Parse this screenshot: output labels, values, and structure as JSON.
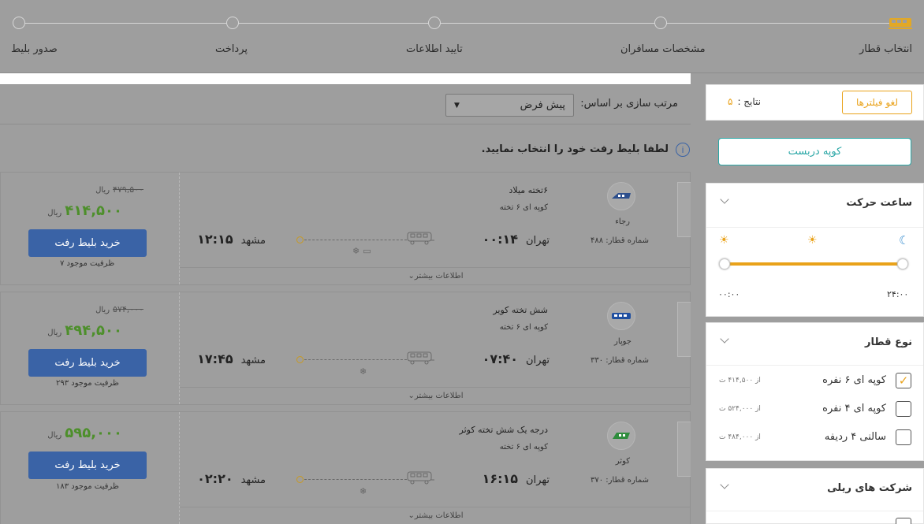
{
  "stepper": {
    "steps": [
      {
        "label": "انتخاب قطار"
      },
      {
        "label": "مشخصات مسافران"
      },
      {
        "label": "تایید اطلاعات"
      },
      {
        "label": "پرداخت"
      },
      {
        "label": "صدور بلیط"
      }
    ]
  },
  "sort": {
    "label": "مرتب سازی بر اساس:",
    "selected": "پیش فرض"
  },
  "notice": "لطفا بلیط رفت خود را انتخاب نمایید.",
  "tickets": [
    {
      "train_name": "۶تخته میلاد",
      "coupe": "کوپه ای ۶ تخته",
      "company": "رجاء",
      "train_number": "شماره قطار: ۴۸۸",
      "origin": "تهران",
      "depart_time": "۰۰:۱۴",
      "destination": "مشهد",
      "arrive_time": "۱۲:۱۵",
      "old_price": "۴۷۹,۵۰۰",
      "old_currency": "ریال",
      "price": "۴۱۴,۵۰۰",
      "currency": "ریال",
      "buy_label": "خرید بلیط رفت",
      "capacity": "ظرفیت موجود ۷",
      "more": "اطلاعات بیشتر"
    },
    {
      "train_name": "شش تخته کویر",
      "coupe": "کوپه ای ۶ تخته",
      "company": "جوپار",
      "train_number": "شماره قطار: ۳۳۰",
      "origin": "تهران",
      "depart_time": "۰۷:۴۰",
      "destination": "مشهد",
      "arrive_time": "۱۷:۴۵",
      "old_price": "۵۷۴,۰۰۰",
      "old_currency": "ریال",
      "price": "۴۹۴,۵۰۰",
      "currency": "ریال",
      "buy_label": "خرید بلیط رفت",
      "capacity": "ظرفیت موجود ۲۹۳",
      "more": "اطلاعات بیشتر"
    },
    {
      "train_name": "درجه یک شش تخته کوثر",
      "coupe": "کوپه ای ۶ تخته",
      "company": "کوثر",
      "train_number": "شماره قطار: ۳۷۰",
      "origin": "تهران",
      "depart_time": "۱۶:۱۵",
      "destination": "مشهد",
      "arrive_time": "۰۲:۲۰",
      "old_price": "",
      "old_currency": "",
      "price": "۵۹۵,۰۰۰",
      "currency": "ریال",
      "buy_label": "خرید بلیط رفت",
      "capacity": "ظرفیت موجود ۱۸۳",
      "more": "اطلاعات بیشتر"
    }
  ],
  "sidebar": {
    "clear_filters": "لغو فیلترها",
    "results_label": "نتایج :",
    "results_count": "۵",
    "coupe_button": "کوپه دربست",
    "departure_section": {
      "title": "ساعت حرکت",
      "start": "۰۰:۰۰",
      "end": "۲۴:۰۰"
    },
    "train_type": {
      "title": "نوع قطار",
      "options": [
        {
          "label": "کوپه ای ۶ نفره",
          "price": "از ۴۱۴,۵۰۰ ت",
          "checked": true
        },
        {
          "label": "کوپه ای ۴ نفره",
          "price": "از ۵۲۴,۰۰۰ ت",
          "checked": false
        },
        {
          "label": "سالنی ۴ ردیفه",
          "price": "از ۴۸۴,۰۰۰ ت",
          "checked": false
        }
      ]
    },
    "companies": {
      "title": "شرکت های ریلی"
    }
  },
  "colors": {
    "accent_orange": "#e9a21a",
    "buy_blue": "#3a63a6",
    "price_green": "#4d8f2b",
    "teal_button": "#2aa7a6"
  }
}
